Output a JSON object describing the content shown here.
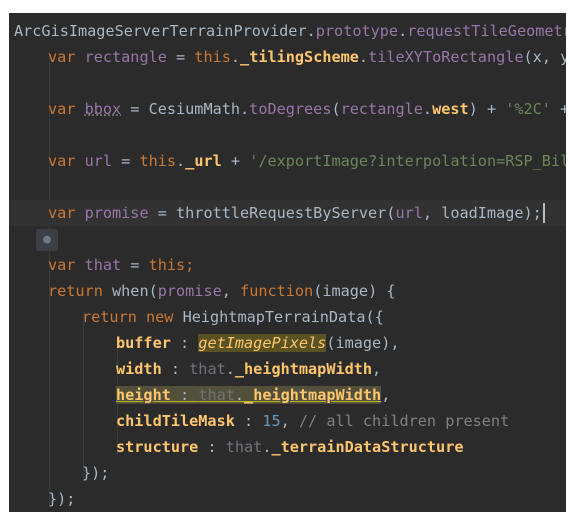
{
  "lines": [
    {
      "indent": 0,
      "parts": [
        {
          "t": "ArcGisImageServerTerrainProvider",
          "c": "local"
        },
        {
          "t": ".",
          "c": "local"
        },
        {
          "t": "prototype",
          "c": "proto"
        },
        {
          "t": ".",
          "c": "local"
        },
        {
          "t": "requestTileGeometry",
          "c": "proto"
        },
        {
          "t": " = ",
          "c": "local"
        }
      ]
    },
    {
      "indent": 1,
      "parts": [
        {
          "t": "var ",
          "c": "kw"
        },
        {
          "t": "rectangle",
          "c": "proto"
        },
        {
          "t": " = ",
          "c": "local"
        },
        {
          "t": "this",
          "c": "kw"
        },
        {
          "t": ".",
          "c": "local"
        },
        {
          "t": "_tilingScheme",
          "c": "prop"
        },
        {
          "t": ".",
          "c": "local"
        },
        {
          "t": "tileXYToRectangle",
          "c": "proto"
        },
        {
          "t": "(x, y, level);",
          "c": "local"
        }
      ]
    },
    {
      "indent": 0,
      "parts": []
    },
    {
      "indent": 1,
      "parts": [
        {
          "t": "var ",
          "c": "kw"
        },
        {
          "t": "bbox",
          "c": "proto dotted"
        },
        {
          "t": " = CesiumMath.",
          "c": "local"
        },
        {
          "t": "toDegrees",
          "c": "proto"
        },
        {
          "t": "(",
          "c": "local"
        },
        {
          "t": "rectangle",
          "c": "proto"
        },
        {
          "t": ".",
          "c": "local"
        },
        {
          "t": "west",
          "c": "prop"
        },
        {
          "t": ") + ",
          "c": "local"
        },
        {
          "t": "'%2C'",
          "c": "str"
        },
        {
          "t": " + CesiumMath",
          "c": "local"
        }
      ]
    },
    {
      "indent": 0,
      "parts": []
    },
    {
      "indent": 1,
      "parts": [
        {
          "t": "var ",
          "c": "kw"
        },
        {
          "t": "url",
          "c": "proto"
        },
        {
          "t": " = ",
          "c": "local"
        },
        {
          "t": "this",
          "c": "kw"
        },
        {
          "t": ".",
          "c": "local"
        },
        {
          "t": "_url",
          "c": "prop"
        },
        {
          "t": " + ",
          "c": "local"
        },
        {
          "t": "'/exportImage?interpolation=RSP_Bilinear'",
          "c": "str"
        }
      ]
    },
    {
      "indent": 0,
      "parts": []
    },
    {
      "indent": 1,
      "current": true,
      "parts": [
        {
          "t": "var ",
          "c": "kw"
        },
        {
          "t": "promise",
          "c": "proto"
        },
        {
          "t": " = throttleRequestByServer(",
          "c": "local"
        },
        {
          "t": "url",
          "c": "proto"
        },
        {
          "t": ", loadImage);",
          "c": "local"
        }
      ]
    },
    {
      "indent": 0,
      "parts": []
    },
    {
      "indent": 1,
      "parts": [
        {
          "t": "var ",
          "c": "kw"
        },
        {
          "t": "that",
          "c": "proto"
        },
        {
          "t": " = ",
          "c": "local"
        },
        {
          "t": "this",
          "c": "kw"
        },
        {
          "t": ";",
          "c": "kw"
        }
      ]
    },
    {
      "indent": 1,
      "parts": [
        {
          "t": "return ",
          "c": "kw"
        },
        {
          "t": "when(",
          "c": "local"
        },
        {
          "t": "promise",
          "c": "proto"
        },
        {
          "t": ", ",
          "c": "local"
        },
        {
          "t": "function",
          "c": "kw"
        },
        {
          "t": "(image) {",
          "c": "local"
        }
      ]
    },
    {
      "indent": 2,
      "parts": [
        {
          "t": "return new ",
          "c": "kw"
        },
        {
          "t": "HeightmapTerrainData({",
          "c": "local"
        }
      ]
    },
    {
      "indent": 3,
      "parts": [
        {
          "t": "buffer",
          "c": "prop"
        },
        {
          "t": " : ",
          "c": "local"
        },
        {
          "t": "getImagePixels",
          "c": "fnit hl2"
        },
        {
          "t": "(image),",
          "c": "local"
        }
      ]
    },
    {
      "indent": 3,
      "parts": [
        {
          "t": "width",
          "c": "prop"
        },
        {
          "t": " : ",
          "c": "local"
        },
        {
          "t": "that",
          "c": "unused"
        },
        {
          "t": ".",
          "c": "local"
        },
        {
          "t": "_heightmapWidth",
          "c": "prop"
        },
        {
          "t": ",",
          "c": "local"
        }
      ]
    },
    {
      "indent": 3,
      "parts": [
        {
          "t": "height",
          "c": "prop hl under"
        },
        {
          "t": " : ",
          "c": "local hl under"
        },
        {
          "t": "that",
          "c": "unused hl under"
        },
        {
          "t": ".",
          "c": "local hl under"
        },
        {
          "t": "_heightmapWidth",
          "c": "prop hl under"
        },
        {
          "t": ",",
          "c": "local"
        }
      ]
    },
    {
      "indent": 3,
      "parts": [
        {
          "t": "childTileMask",
          "c": "prop"
        },
        {
          "t": " : ",
          "c": "local"
        },
        {
          "t": "15",
          "c": "num"
        },
        {
          "t": ", ",
          "c": "local"
        },
        {
          "t": "// all children present",
          "c": "cmt"
        }
      ]
    },
    {
      "indent": 3,
      "parts": [
        {
          "t": "structure",
          "c": "prop"
        },
        {
          "t": " : ",
          "c": "local"
        },
        {
          "t": "that",
          "c": "unused"
        },
        {
          "t": ".",
          "c": "local"
        },
        {
          "t": "_terrainDataStructure",
          "c": "prop"
        }
      ]
    },
    {
      "indent": 2,
      "parts": [
        {
          "t": "});",
          "c": "local"
        }
      ]
    },
    {
      "indent": 1,
      "parts": [
        {
          "t": "});",
          "c": "local"
        }
      ]
    }
  ],
  "bulb_icon": "intention-bulb-icon"
}
